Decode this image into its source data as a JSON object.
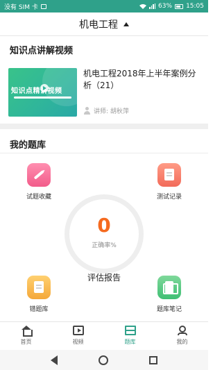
{
  "status_bar": {
    "carrier": "没有 SIM 卡",
    "battery": "63%",
    "time": "15:05"
  },
  "header": {
    "title": "机电工程"
  },
  "sections": {
    "videos_title": "知识点讲解视频",
    "question_bank_title": "我的题库"
  },
  "video_card": {
    "thumbnail_text": "知识点精讲视频",
    "title": "机电工程2018年上半年案例分析（21）",
    "lecturer": "讲师: 胡秋萍"
  },
  "question_bank": {
    "tiles": [
      {
        "label": "试题收藏",
        "icon": "pencil-icon",
        "color": "#f25c8a"
      },
      {
        "label": "测试记录",
        "icon": "record-icon",
        "color": "#f26b5a"
      },
      {
        "label": "错题库",
        "icon": "document-icon",
        "color": "#f4a83a"
      },
      {
        "label": "题库笔记",
        "icon": "notebook-icon",
        "color": "#3fbf74"
      }
    ],
    "accuracy_value": "0",
    "accuracy_label": "正确率%",
    "report_label": "评估报告"
  },
  "bottom_nav": {
    "items": [
      {
        "label": "首页",
        "icon": "home-icon",
        "active": false
      },
      {
        "label": "视频",
        "icon": "video-icon",
        "active": false
      },
      {
        "label": "题库",
        "icon": "question-bank-icon",
        "active": true
      },
      {
        "label": "我的",
        "icon": "profile-icon",
        "active": false
      }
    ]
  },
  "colors": {
    "accent": "#2fa18a",
    "score": "#f56a1f"
  }
}
